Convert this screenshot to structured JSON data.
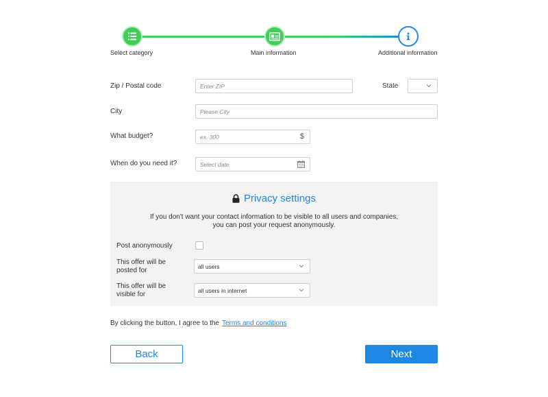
{
  "stepper": {
    "steps": [
      {
        "label": "Select category",
        "icon": "list-icon",
        "state": "done"
      },
      {
        "label": "Main information",
        "icon": "id-card-icon",
        "state": "done"
      },
      {
        "label": "Additional information",
        "icon": "info-icon",
        "state": "current"
      }
    ]
  },
  "form": {
    "zip": {
      "label": "Zip / Postal code",
      "placeholder": "Enter ZIP"
    },
    "state": {
      "label": "State",
      "value": ""
    },
    "city": {
      "label": "City",
      "placeholder": "Please City"
    },
    "budget": {
      "label": "What budget?",
      "placeholder": "ex. 300",
      "suffix": "$"
    },
    "date": {
      "label": "When do you need it?",
      "placeholder": "Select date"
    }
  },
  "privacy": {
    "title": "Privacy settings",
    "desc_line1": "If you don't want your contact information to be visible to all users and companies,",
    "desc_line2": "you can post your request anonymously.",
    "anon_label": "Post anonymously",
    "anon_checked": false,
    "posted_for_line1": "This offer will be",
    "posted_for_line2": "posted for",
    "posted_for_value": "all users",
    "visible_for_line1": "This offer will be",
    "visible_for_line2": "visible for",
    "visible_for_value": "all users in internet"
  },
  "terms": {
    "text": "By clicking the button, I agree to the",
    "link": "Terms and conditions"
  },
  "buttons": {
    "back": "Back",
    "next": "Next"
  },
  "colors": {
    "accent": "#1e88e5",
    "success": "#3fce5a",
    "panel_bg": "#f3f3f3"
  }
}
